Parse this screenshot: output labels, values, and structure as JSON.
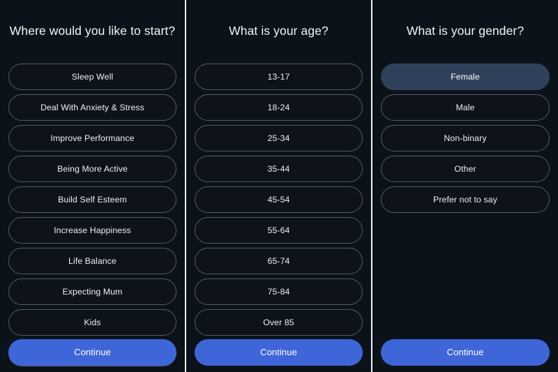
{
  "app": {
    "background_color": "#0b1219",
    "divider_color": "#f2f4f7",
    "accent_color": "#3f66d8",
    "selected_color": "#2f415a",
    "pill_border_color": "#535c66",
    "text_color": "#eef1f4"
  },
  "panels": [
    {
      "id": "start-topic",
      "title": "Where would you like to start?",
      "continue_label": "Continue",
      "options": [
        {
          "label": "Sleep Well",
          "selected": false
        },
        {
          "label": "Deal With Anxiety & Stress",
          "selected": false
        },
        {
          "label": "Improve Performance",
          "selected": false
        },
        {
          "label": "Being More Active",
          "selected": false
        },
        {
          "label": "Build Self Esteem",
          "selected": false
        },
        {
          "label": "Increase Happiness",
          "selected": false
        },
        {
          "label": "Life Balance",
          "selected": false
        },
        {
          "label": "Expecting Mum",
          "selected": false
        },
        {
          "label": "Kids",
          "selected": false
        },
        {
          "label": "",
          "selected": false
        }
      ]
    },
    {
      "id": "age",
      "title": "What is your age?",
      "continue_label": "Continue",
      "options": [
        {
          "label": "13-17",
          "selected": false
        },
        {
          "label": "18-24",
          "selected": false
        },
        {
          "label": "25-34",
          "selected": false
        },
        {
          "label": "35-44",
          "selected": false
        },
        {
          "label": "45-54",
          "selected": false
        },
        {
          "label": "55-64",
          "selected": false
        },
        {
          "label": "65-74",
          "selected": false
        },
        {
          "label": "75-84",
          "selected": false
        },
        {
          "label": "Over 85",
          "selected": false
        }
      ]
    },
    {
      "id": "gender",
      "title": "What is your gender?",
      "continue_label": "Continue",
      "options": [
        {
          "label": "Female",
          "selected": true
        },
        {
          "label": "Male",
          "selected": false
        },
        {
          "label": "Non-binary",
          "selected": false
        },
        {
          "label": "Other",
          "selected": false
        },
        {
          "label": "Prefer not to say",
          "selected": false
        }
      ]
    }
  ]
}
